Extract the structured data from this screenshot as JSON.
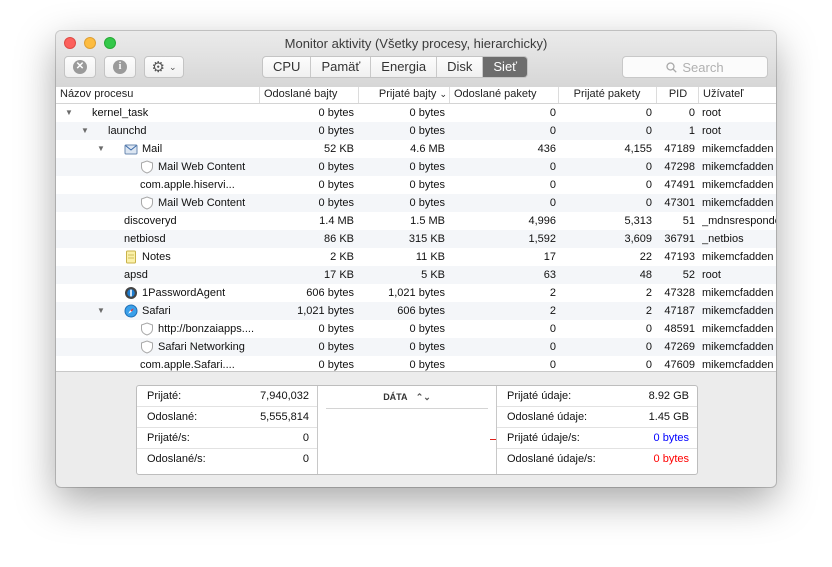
{
  "window": {
    "title": "Monitor aktivity (Všetky procesy, hierarchicky)"
  },
  "toolbar": {
    "stop_glyph": "✕",
    "info_glyph": "i",
    "gear_glyph": "⚙",
    "menu_chevron": "⌄",
    "tabs": [
      {
        "label": "CPU",
        "active": false
      },
      {
        "label": "Pamäť",
        "active": false
      },
      {
        "label": "Energia",
        "active": false
      },
      {
        "label": "Disk",
        "active": false
      },
      {
        "label": "Sieť",
        "active": true
      }
    ],
    "search_placeholder": "Search"
  },
  "columns": {
    "name": "Názov procesu",
    "sent_bytes": "Odoslané bajty",
    "rcvd_bytes": "Prijaté bajty",
    "sort_arrow": "⌄",
    "sent_packets": "Odoslané pakety",
    "rcvd_packets": "Prijaté pakety",
    "pid": "PID",
    "user": "Užívateľ"
  },
  "rows": [
    {
      "name": "kernel_task",
      "sent": "0 bytes",
      "rcvd": "0 bytes",
      "spk": "0",
      "rpk": "0",
      "pid": "0",
      "user": "root"
    },
    {
      "name": "launchd",
      "sent": "0 bytes",
      "rcvd": "0 bytes",
      "spk": "0",
      "rpk": "0",
      "pid": "1",
      "user": "root"
    },
    {
      "name": "Mail",
      "sent": "52 KB",
      "rcvd": "4.6 MB",
      "spk": "436",
      "rpk": "4,155",
      "pid": "47189",
      "user": "mikemcfadden"
    },
    {
      "name": "Mail Web Content",
      "sent": "0 bytes",
      "rcvd": "0 bytes",
      "spk": "0",
      "rpk": "0",
      "pid": "47298",
      "user": "mikemcfadden"
    },
    {
      "name": "com.apple.hiservi...",
      "sent": "0 bytes",
      "rcvd": "0 bytes",
      "spk": "0",
      "rpk": "0",
      "pid": "47491",
      "user": "mikemcfadden"
    },
    {
      "name": "Mail Web Content",
      "sent": "0 bytes",
      "rcvd": "0 bytes",
      "spk": "0",
      "rpk": "0",
      "pid": "47301",
      "user": "mikemcfadden"
    },
    {
      "name": "discoveryd",
      "sent": "1.4 MB",
      "rcvd": "1.5 MB",
      "spk": "4,996",
      "rpk": "5,313",
      "pid": "51",
      "user": "_mdnsresponder"
    },
    {
      "name": "netbiosd",
      "sent": "86 KB",
      "rcvd": "315 KB",
      "spk": "1,592",
      "rpk": "3,609",
      "pid": "36791",
      "user": "_netbios"
    },
    {
      "name": "Notes",
      "sent": "2 KB",
      "rcvd": "11 KB",
      "spk": "17",
      "rpk": "22",
      "pid": "47193",
      "user": "mikemcfadden"
    },
    {
      "name": "apsd",
      "sent": "17 KB",
      "rcvd": "5 KB",
      "spk": "63",
      "rpk": "48",
      "pid": "52",
      "user": "root"
    },
    {
      "name": "1PasswordAgent",
      "sent": "606 bytes",
      "rcvd": "1,021 bytes",
      "spk": "2",
      "rpk": "2",
      "pid": "47328",
      "user": "mikemcfadden"
    },
    {
      "name": "Safari",
      "sent": "1,021 bytes",
      "rcvd": "606 bytes",
      "spk": "2",
      "rpk": "2",
      "pid": "47187",
      "user": "mikemcfadden"
    },
    {
      "name": "http://bonzaiapps....",
      "sent": "0 bytes",
      "rcvd": "0 bytes",
      "spk": "0",
      "rpk": "0",
      "pid": "48591",
      "user": "mikemcfadden"
    },
    {
      "name": "Safari Networking",
      "sent": "0 bytes",
      "rcvd": "0 bytes",
      "spk": "0",
      "rpk": "0",
      "pid": "47269",
      "user": "mikemcfadden"
    },
    {
      "name": "com.apple.Safari....",
      "sent": "0 bytes",
      "rcvd": "0 bytes",
      "spk": "0",
      "rpk": "0",
      "pid": "47609",
      "user": "mikemcfadden"
    }
  ],
  "summary": {
    "left": [
      {
        "label": "Prijaté:",
        "value": "7,940,032"
      },
      {
        "label": "Odoslané:",
        "value": "5,555,814"
      },
      {
        "label": "Prijaté/s:",
        "value": "0"
      },
      {
        "label": "Odoslané/s:",
        "value": "0"
      }
    ],
    "middle": {
      "label": "DÁTA",
      "chevron": "⌃⌄"
    },
    "right": [
      {
        "label": "Prijaté údaje:",
        "value": "8.92 GB",
        "color": "#111111"
      },
      {
        "label": "Odoslané údaje:",
        "value": "1.45 GB",
        "color": "#111111"
      },
      {
        "label": "Prijaté údaje/s:",
        "value": "0 bytes",
        "color": "#0000ff"
      },
      {
        "label": "Odoslané údaje/s:",
        "value": "0 bytes",
        "color": "#ff0000"
      }
    ]
  },
  "colors": {
    "received_rate": "#0000ff",
    "sent_rate": "#ff0000"
  }
}
